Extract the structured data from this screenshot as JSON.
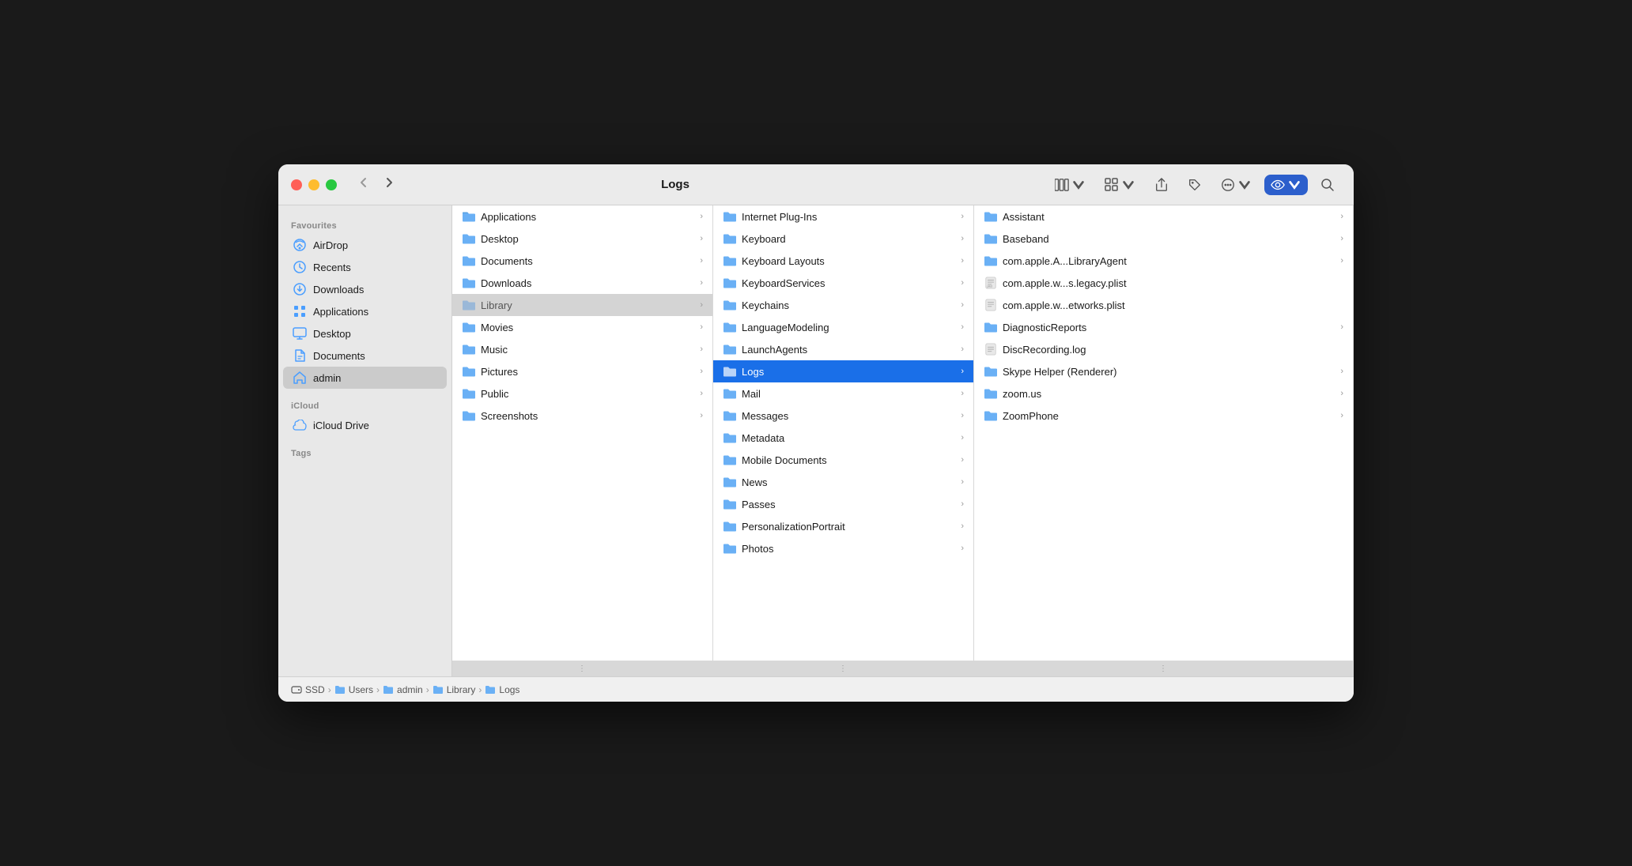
{
  "window": {
    "title": "Logs"
  },
  "toolbar": {
    "back_label": "‹",
    "forward_label": "›",
    "search_label": "🔍"
  },
  "sidebar": {
    "favourites_label": "Favourites",
    "icloud_label": "iCloud",
    "tags_label": "Tags",
    "items": [
      {
        "id": "airdrop",
        "label": "AirDrop",
        "icon": "airdrop"
      },
      {
        "id": "recents",
        "label": "Recents",
        "icon": "recents"
      },
      {
        "id": "downloads",
        "label": "Downloads",
        "icon": "downloads"
      },
      {
        "id": "applications",
        "label": "Applications",
        "icon": "applications"
      },
      {
        "id": "desktop",
        "label": "Desktop",
        "icon": "desktop"
      },
      {
        "id": "documents",
        "label": "Documents",
        "icon": "documents"
      },
      {
        "id": "admin",
        "label": "admin",
        "icon": "home",
        "active": true
      }
    ],
    "icloud_items": [
      {
        "id": "icloud-drive",
        "label": "iCloud Drive",
        "icon": "icloud"
      }
    ]
  },
  "column1": {
    "items": [
      {
        "label": "Applications",
        "has_children": true
      },
      {
        "label": "Desktop",
        "has_children": true
      },
      {
        "label": "Documents",
        "has_children": true
      },
      {
        "label": "Downloads",
        "has_children": true
      },
      {
        "label": "Library",
        "has_children": true,
        "highlighted": true
      },
      {
        "label": "Movies",
        "has_children": true
      },
      {
        "label": "Music",
        "has_children": true
      },
      {
        "label": "Pictures",
        "has_children": true
      },
      {
        "label": "Public",
        "has_children": true
      },
      {
        "label": "Screenshots",
        "has_children": true
      }
    ]
  },
  "column2": {
    "items": [
      {
        "label": "Internet Plug-Ins",
        "has_children": true
      },
      {
        "label": "Keyboard",
        "has_children": true
      },
      {
        "label": "Keyboard Layouts",
        "has_children": true
      },
      {
        "label": "KeyboardServices",
        "has_children": true
      },
      {
        "label": "Keychains",
        "has_children": true
      },
      {
        "label": "LanguageModeling",
        "has_children": true
      },
      {
        "label": "LaunchAgents",
        "has_children": true
      },
      {
        "label": "Logs",
        "has_children": true,
        "selected": true
      },
      {
        "label": "Mail",
        "has_children": true
      },
      {
        "label": "Messages",
        "has_children": true
      },
      {
        "label": "Metadata",
        "has_children": true
      },
      {
        "label": "Mobile Documents",
        "has_children": true
      },
      {
        "label": "News",
        "has_children": true
      },
      {
        "label": "Passes",
        "has_children": true
      },
      {
        "label": "PersonalizationPortrait",
        "has_children": true
      },
      {
        "label": "Photos",
        "has_children": true
      }
    ]
  },
  "column3": {
    "items": [
      {
        "label": "Assistant",
        "has_children": true,
        "type": "folder"
      },
      {
        "label": "Baseband",
        "has_children": true,
        "type": "folder"
      },
      {
        "label": "com.apple.A...LibraryAgent",
        "has_children": true,
        "type": "folder"
      },
      {
        "label": "com.apple.w...s.legacy.plist",
        "has_children": false,
        "type": "file"
      },
      {
        "label": "com.apple.w...etworks.plist",
        "has_children": false,
        "type": "file"
      },
      {
        "label": "DiagnosticReports",
        "has_children": true,
        "type": "folder"
      },
      {
        "label": "DiscRecording.log",
        "has_children": false,
        "type": "file"
      },
      {
        "label": "Skype Helper (Renderer)",
        "has_children": true,
        "type": "folder"
      },
      {
        "label": "zoom.us",
        "has_children": true,
        "type": "folder"
      },
      {
        "label": "ZoomPhone",
        "has_children": true,
        "type": "folder"
      }
    ]
  },
  "breadcrumb": {
    "items": [
      {
        "label": "SSD",
        "icon": "drive"
      },
      {
        "label": "Users",
        "icon": "folder"
      },
      {
        "label": "admin",
        "icon": "folder"
      },
      {
        "label": "Library",
        "icon": "folder"
      },
      {
        "label": "Logs",
        "icon": "folder"
      }
    ]
  }
}
